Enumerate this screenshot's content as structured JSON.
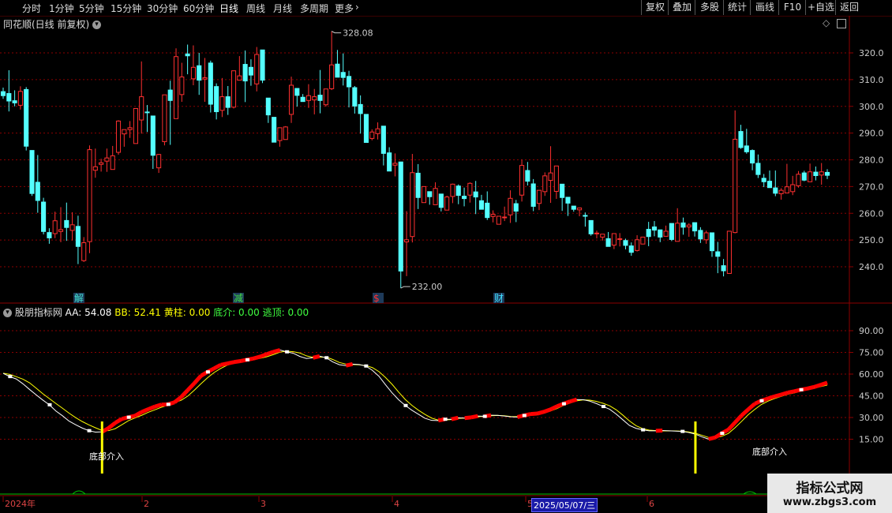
{
  "toolbar": {
    "periods": [
      "分时",
      "1分钟",
      "5分钟",
      "15分钟",
      "30分钟",
      "60分钟",
      "日线",
      "周线",
      "月线",
      "多周期",
      "更多"
    ],
    "active_period": "日线",
    "more_icon": "chevron-right-icon",
    "buttons": [
      "复权",
      "叠加",
      "多股",
      "统计",
      "画线",
      "F10",
      "+自选",
      "返回"
    ]
  },
  "price_pane": {
    "title": "同花顺(日线 前复权)",
    "title_icon": "chevron-down-circle-icon",
    "right_icons": [
      "diamond-icon",
      "panel-toggle-icon"
    ],
    "high_label": "328.08",
    "low_label": "232.00",
    "axis_ticks": [
      "320.0",
      "310.0",
      "300.0",
      "290.0",
      "280.0",
      "270.0",
      "260.0",
      "250.0",
      "240.0"
    ],
    "event_labels": [
      {
        "text": "解",
        "color": "#40e0d0"
      },
      {
        "text": "减",
        "color": "#40e040"
      },
      {
        "text": "$",
        "color": "#ff3030"
      },
      {
        "text": "财",
        "color": "#40e0ff"
      }
    ],
    "colors": {
      "up": "#ff3030",
      "down": "#54ffff",
      "grid": "#8b0000"
    }
  },
  "indicator_pane": {
    "name": "股朋指标网",
    "aa_label": "AA: 54.08",
    "bb_label": "BB: 52.41",
    "yellow_label": "黄柱: 0.00",
    "bottom_label": "底介: 0.00",
    "top_label": "逃顶: 0.00",
    "axis_ticks": [
      "90.00",
      "75.00",
      "60.00",
      "45.00",
      "30.00",
      "15.00"
    ],
    "signal_text_1": "底部介入",
    "signal_text_2": "底部介入",
    "colors": {
      "aa": "#ffffff",
      "bb": "#ffff00",
      "rise": "#ff0000",
      "signal": "#ffff00"
    }
  },
  "time_axis": {
    "labels": [
      "2024年",
      "2",
      "3",
      "4",
      "5",
      "6"
    ],
    "cursor_date": "2025/05/07/三"
  },
  "watermark": {
    "line1": "指标公式网",
    "line2": "www.zbgs3.com"
  },
  "chart_data": {
    "type": "candlestick",
    "ylim": [
      232,
      328
    ],
    "candles": [
      [
        305.5,
        307.0,
        304.0,
        302.8
      ],
      [
        304.8,
        313.5,
        302.0,
        298.1
      ],
      [
        302.1,
        306.0,
        301.3,
        300.0
      ],
      [
        300.4,
        307.5,
        305.6,
        298.8
      ],
      [
        306.3,
        307.2,
        285.1,
        283.5
      ],
      [
        283.5,
        283.5,
        267.4,
        266.5
      ],
      [
        271.6,
        281.8,
        264.8,
        260.2
      ],
      [
        264.2,
        265.8,
        253.2,
        252.1
      ],
      [
        252.8,
        254.4,
        250.8,
        248.6
      ],
      [
        252.4,
        260.6,
        257.2,
        250.7
      ],
      [
        253.2,
        262.3,
        253.9,
        249.2
      ],
      [
        257.3,
        264.0,
        254.7,
        249.7
      ],
      [
        253.6,
        260.4,
        255.7,
        249.8
      ],
      [
        255.1,
        259.1,
        247.6,
        241.0
      ],
      [
        242.3,
        251.1,
        249.0,
        241.8
      ],
      [
        249.4,
        285.4,
        283.8,
        245.1
      ],
      [
        276.1,
        284.2,
        277.4,
        273.3
      ],
      [
        278.3,
        280.4,
        278.9,
        275.6
      ],
      [
        279.5,
        284.2,
        280.7,
        275.5
      ],
      [
        276.4,
        285.2,
        281.5,
        276.4
      ],
      [
        282.8,
        294.8,
        294.5,
        281.9
      ],
      [
        289.7,
        290.3,
        291.3,
        284.9
      ],
      [
        291.3,
        294.5,
        292.0,
        288.2
      ],
      [
        286.1,
        293.1,
        299.2,
        287.3
      ],
      [
        294.9,
        316.8,
        303.6,
        289.8
      ],
      [
        297.9,
        300.5,
        297.6,
        290.4
      ],
      [
        296.4,
        295.5,
        281.7,
        276.6
      ],
      [
        277.0,
        282.2,
        282.0,
        275.1
      ],
      [
        286.8,
        302.3,
        304.3,
        285.4
      ],
      [
        306.1,
        309.6,
        302.2,
        285.6
      ],
      [
        295.4,
        321.7,
        318.6,
        295.6
      ],
      [
        304.4,
        316.3,
        311.0,
        301.7
      ],
      [
        319.6,
        323.1,
        318.9,
        312.0
      ],
      [
        310.3,
        322.8,
        314.6,
        307.9
      ],
      [
        315.2,
        320.0,
        309.8,
        304.3
      ],
      [
        310.2,
        318.1,
        310.7,
        301.7
      ],
      [
        316.2,
        317.1,
        300.8,
        297.7
      ],
      [
        307.4,
        308.6,
        298.0,
        295.1
      ],
      [
        298.5,
        310.6,
        303.6,
        296.0
      ],
      [
        303.6,
        307.6,
        299.6,
        296.8
      ],
      [
        299.7,
        307.0,
        313.3,
        299.2
      ],
      [
        309.8,
        318.8,
        311.4,
        310.2
      ],
      [
        315.7,
        320.9,
        309.5,
        301.6
      ],
      [
        314.6,
        317.6,
        311.7,
        307.7
      ],
      [
        308.4,
        322.2,
        319.4,
        305.6
      ],
      [
        321.1,
        316.2,
        309.8,
        308.7
      ],
      [
        303.1,
        298.6,
        296.8,
        293.8
      ],
      [
        295.9,
        296.0,
        286.6,
        288.7
      ],
      [
        287.2,
        290.7,
        292.0,
        284.9
      ],
      [
        287.6,
        292.6,
        292.3,
        290.2
      ],
      [
        297.0,
        311.1,
        307.9,
        293.8
      ],
      [
        306.7,
        306.8,
        304.1,
        299.9
      ],
      [
        303.4,
        304.6,
        301.8,
        302.5
      ],
      [
        302.2,
        308.3,
        304.0,
        299.4
      ],
      [
        302.4,
        306.5,
        303.6,
        297.0
      ],
      [
        304.2,
        313.6,
        302.2,
        297.4
      ],
      [
        300.6,
        305.2,
        306.5,
        299.9
      ],
      [
        306.6,
        328.1,
        315.5,
        306.1
      ],
      [
        315.8,
        321.1,
        310.9,
        311.5
      ],
      [
        312.7,
        319.8,
        310.8,
        307.8
      ],
      [
        311.2,
        313.3,
        307.3,
        299.6
      ],
      [
        307.0,
        307.6,
        300.1,
        297.3
      ],
      [
        300.7,
        304.1,
        297.3,
        289.8
      ],
      [
        297.0,
        296.4,
        286.5,
        288.6
      ],
      [
        288.0,
        291.4,
        290.4,
        287.3
      ],
      [
        289.8,
        294.0,
        291.6,
        287.6
      ],
      [
        292.6,
        288.7,
        282.4,
        277.9
      ],
      [
        282.6,
        284.7,
        275.8,
        276.6
      ],
      [
        278.0,
        282.4,
        278.7,
        273.8
      ],
      [
        279.2,
        263.8,
        238.4,
        232.0
      ],
      [
        249.3,
        260.8,
        250.1,
        236.5
      ],
      [
        251.3,
        282.2,
        275.2,
        249.1
      ],
      [
        275.0,
        278.4,
        265.9,
        261.6
      ],
      [
        264.0,
        267.3,
        270.0,
        264.3
      ],
      [
        268.1,
        268.2,
        266.2,
        263.2
      ],
      [
        263.2,
        271.6,
        269.3,
        267.3
      ],
      [
        267.2,
        266.3,
        262.2,
        260.7
      ],
      [
        261.2,
        266.6,
        266.1,
        261.2
      ],
      [
        266.3,
        271.1,
        270.9,
        263.8
      ],
      [
        270.2,
        270.8,
        266.7,
        263.4
      ],
      [
        266.4,
        269.6,
        265.5,
        262.6
      ],
      [
        266.8,
        271.6,
        271.2,
        264.0
      ],
      [
        268.0,
        272.1,
        266.1,
        259.7
      ],
      [
        264.7,
        266.9,
        261.5,
        262.2
      ],
      [
        263.8,
        268.2,
        258.4,
        257.5
      ],
      [
        258.8,
        261.1,
        259.6,
        256.6
      ],
      [
        255.9,
        258.4,
        258.9,
        255.9
      ],
      [
        258.6,
        262.5,
        258.6,
        257.1
      ],
      [
        259.4,
        268.6,
        265.6,
        256.4
      ],
      [
        263.6,
        265.0,
        260.8,
        256.7
      ],
      [
        266.8,
        280.1,
        277.9,
        264.4
      ],
      [
        276.0,
        279.2,
        272.0,
        270.4
      ],
      [
        271.0,
        272.8,
        262.6,
        260.8
      ],
      [
        263.7,
        265.9,
        268.6,
        261.2
      ],
      [
        268.1,
        275.3,
        274.0,
        266.5
      ],
      [
        272.3,
        285.1,
        275.1,
        263.9
      ],
      [
        268.2,
        271.2,
        277.7,
        265.4
      ],
      [
        270.9,
        268.9,
        265.9,
        260.9
      ],
      [
        266.0,
        264.9,
        263.8,
        259.0
      ],
      [
        262.7,
        262.1,
        261.5,
        260.6
      ],
      [
        261.3,
        261.2,
        262.0,
        258.9
      ],
      [
        259.2,
        260.3,
        259.1,
        255.0
      ],
      [
        257.3,
        256.1,
        252.3,
        251.6
      ],
      [
        252.5,
        253.5,
        252.6,
        250.6
      ],
      [
        251.1,
        251.8,
        252.2,
        249.8
      ],
      [
        250.5,
        253.0,
        247.6,
        248.5
      ],
      [
        248.1,
        250.7,
        252.4,
        246.6
      ],
      [
        250.2,
        252.6,
        250.5,
        247.6
      ],
      [
        249.8,
        250.5,
        248.0,
        246.5
      ],
      [
        247.8,
        249.1,
        245.4,
        244.1
      ],
      [
        246.1,
        251.8,
        250.1,
        245.7
      ],
      [
        248.5,
        251.1,
        251.1,
        248.4
      ],
      [
        254.0,
        256.8,
        251.3,
        247.7
      ],
      [
        254.9,
        257.1,
        253.7,
        251.4
      ],
      [
        253.8,
        253.7,
        251.1,
        249.2
      ],
      [
        251.4,
        255.4,
        253.3,
        252.3
      ],
      [
        256.2,
        255.7,
        250.2,
        249.6
      ],
      [
        249.5,
        261.9,
        256.3,
        250.7
      ],
      [
        256.4,
        258.4,
        254.8,
        252.0
      ],
      [
        254.9,
        256.3,
        255.6,
        251.2
      ],
      [
        256.5,
        254.4,
        253.4,
        251.3
      ],
      [
        253.6,
        254.8,
        250.4,
        248.9
      ],
      [
        250.1,
        253.5,
        252.7,
        248.6
      ],
      [
        252.7,
        250.8,
        246.0,
        243.7
      ],
      [
        245.6,
        249.3,
        243.9,
        237.6
      ],
      [
        240.4,
        242.9,
        238.5,
        236.4
      ],
      [
        237.5,
        251.5,
        253.3,
        239.0
      ],
      [
        252.8,
        298.5,
        287.7,
        252.5
      ],
      [
        290.6,
        293.1,
        284.6,
        284.1
      ],
      [
        285.2,
        291.6,
        283.0,
        282.3
      ],
      [
        283.5,
        283.9,
        278.8,
        276.1
      ],
      [
        278.7,
        282.0,
        274.5,
        273.2
      ],
      [
        273.1,
        274.7,
        271.8,
        269.8
      ],
      [
        272.0,
        276.0,
        269.6,
        269.9
      ],
      [
        269.5,
        276.0,
        267.5,
        266.4
      ],
      [
        267.3,
        269.4,
        268.6,
        265.1
      ],
      [
        267.6,
        278.5,
        269.9,
        269.6
      ],
      [
        268.1,
        274.0,
        270.7,
        266.8
      ],
      [
        270.3,
        275.8,
        274.6,
        269.6
      ],
      [
        275.1,
        275.9,
        272.4,
        272.0
      ],
      [
        271.8,
        278.6,
        275.5,
        275.0
      ],
      [
        275.4,
        277.5,
        274.1,
        272.3
      ],
      [
        274.3,
        278.8,
        275.5,
        270.7
      ],
      [
        275.3,
        276.5,
        274.2,
        272.8
      ]
    ],
    "indicator": {
      "ylim": [
        10,
        100
      ],
      "aa": [
        60.5,
        58.3,
        56.6,
        53.3,
        49.4,
        45.7,
        42.1,
        38.8,
        34.5,
        31.2,
        27.5,
        25.0,
        22.7,
        20.9,
        19.9,
        20.1,
        22.7,
        26.3,
        29.0,
        30.2,
        31.2,
        33.8,
        35.7,
        37.5,
        38.9,
        39.1,
        40.5,
        44.1,
        48.9,
        53.7,
        58.8,
        61.5,
        63.9,
        66.4,
        67.3,
        68.3,
        69.0,
        69.9,
        70.8,
        72.1,
        73.8,
        75.4,
        76.6,
        75.4,
        74.4,
        72.2,
        70.8,
        71.3,
        72.4,
        71.3,
        68.4,
        66.5,
        65.9,
        66.9,
        66.6,
        65.6,
        62.6,
        58.5,
        52.6,
        47.0,
        42.2,
        38.3,
        35.0,
        32.2,
        29.4,
        28.0,
        27.9,
        28.8,
        28.8,
        29.8,
        29.6,
        30.1,
        31.0,
        30.8,
        31.6,
        31.5,
        31.0,
        30.5,
        30.3,
        31.4,
        32.4,
        32.7,
        33.9,
        35.5,
        37.7,
        39.5,
        41.1,
        42.4,
        42.3,
        41.3,
        39.6,
        37.6,
        35.7,
        32.3,
        28.4,
        24.5,
        22.5,
        21.5,
        20.8,
        20.8,
        21.0,
        20.8,
        20.6,
        20.4,
        19.6,
        18.5,
        16.6,
        15.1,
        16.2,
        19.1,
        21.6,
        26.5,
        31.4,
        35.5,
        39.5,
        41.6,
        43.1,
        44.6,
        45.8,
        47.2,
        48.1,
        49.2,
        50.0,
        51.1,
        52.6,
        54.1
      ],
      "bb": [
        60.6,
        59.8,
        58.2,
        56.5,
        54.0,
        50.3,
        46.5,
        43.1,
        39.7,
        36.4,
        33.0,
        29.9,
        27.2,
        24.9,
        22.9,
        21.0,
        20.9,
        22.3,
        25.0,
        27.8,
        29.7,
        31.5,
        33.6,
        35.3,
        37.1,
        38.5,
        40.3,
        41.9,
        44.8,
        48.9,
        53.3,
        57.5,
        61.1,
        63.9,
        66.2,
        67.4,
        68.5,
        69.3,
        70.1,
        70.9,
        72.0,
        73.5,
        75.2,
        75.8,
        75.5,
        74.6,
        72.6,
        71.6,
        71.6,
        71.8,
        70.1,
        68.0,
        66.9,
        66.6,
        66.4,
        65.9,
        64.5,
        61.7,
        57.6,
        52.9,
        47.5,
        42.4,
        38.4,
        35.0,
        32.1,
        29.6,
        28.2,
        28.3,
        28.6,
        29.4,
        29.6,
        30.0,
        30.5,
        30.9,
        31.2,
        31.4,
        31.2,
        30.7,
        30.6,
        30.8,
        31.5,
        32.1,
        33.2,
        34.4,
        36.2,
        38.3,
        40.0,
        41.5,
        42.2,
        42.0,
        41.1,
        39.8,
        38.1,
        35.3,
        31.6,
        27.6,
        24.3,
        22.3,
        21.3,
        20.9,
        20.7,
        20.8,
        20.7,
        20.5,
        20.0,
        19.1,
        17.7,
        16.2,
        15.8,
        17.0,
        19.0,
        22.9,
        27.3,
        31.9,
        35.6,
        39.0,
        41.3,
        43.1,
        44.6,
        46.0,
        47.0,
        48.2,
        49.2,
        50.2,
        51.3,
        52.4
      ]
    }
  }
}
